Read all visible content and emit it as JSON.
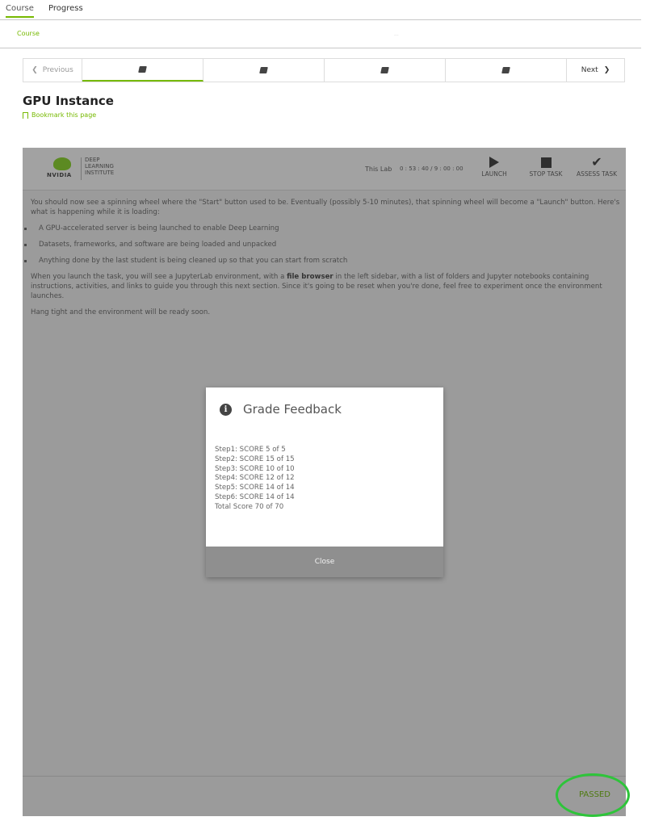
{
  "top_tabs": [
    {
      "label": "Course"
    },
    {
      "label": "Progress"
    }
  ],
  "breadcrumb": "Course",
  "sequence_nav": {
    "prev_label": "Previous",
    "next_label": "Next",
    "units": [
      "book-icon",
      "book-icon",
      "book-icon",
      "book-icon"
    ]
  },
  "page": {
    "title": "GPU Instance",
    "bookmark_label": "Bookmark this page"
  },
  "lab": {
    "brand": {
      "logo_text": "NVIDIA",
      "dli_lines": [
        "DEEP",
        "LEARNING",
        "INSTITUTE"
      ]
    },
    "timer_label": "This Lab",
    "timer_value": "0 : 53 : 40 / 9 : 00 : 00",
    "buttons": {
      "launch": "LAUNCH",
      "stop": "STOP TASK",
      "assess": "ASSESS TASK"
    },
    "intro": "You should now see a spinning wheel where the \"Start\" button used to be. Eventually (possibly 5-10 minutes), that spinning wheel will become a \"Launch\" button. Here's what is happening while it is loading:",
    "bullets": [
      "A GPU-accelerated server is being launched to enable Deep Learning",
      "Datasets, frameworks, and software are being loaded and unpacked",
      "Anything done by the last student is being cleaned up so that you can start from scratch"
    ],
    "para2_before": "When you launch the task, you will see a JupyterLab environment, with a ",
    "para2_bold": "file browser",
    "para2_after": " in the left sidebar, with a list of folders and Jupyter notebooks containing instructions, activities, and links to guide you through this next section. Since it's going to be reset when you're done, feel free to experiment once the environment launches.",
    "para3": "Hang tight and the environment will be ready soon.",
    "status": "PASSED"
  },
  "modal": {
    "title": "Grade Feedback",
    "lines": [
      "Step1: SCORE 5 of 5",
      "Step2: SCORE 15 of 15",
      "Step3: SCORE 10 of 10",
      "Step4: SCORE 12 of 12",
      "Step5: SCORE 14 of 14",
      "Step6: SCORE 14 of 14",
      "Total Score 70 of 70"
    ],
    "close_label": "Close"
  },
  "colors": {
    "accent": "#76b900",
    "passed_circle": "#2ec43a",
    "overlay": "#9b9b9b"
  }
}
